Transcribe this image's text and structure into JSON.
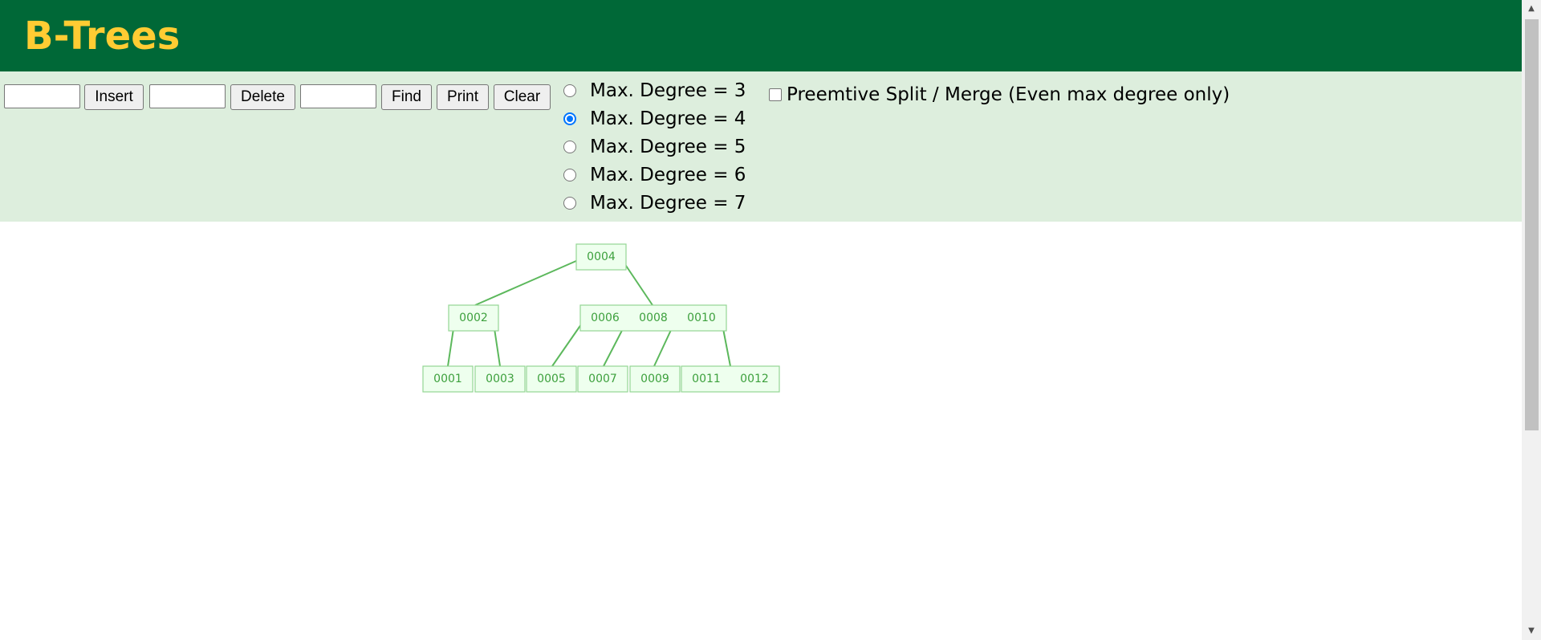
{
  "header": {
    "title": "B-Trees"
  },
  "toolbar": {
    "insert_value": "",
    "insert_label": "Insert",
    "delete_value": "",
    "delete_label": "Delete",
    "find_value": "",
    "find_label": "Find",
    "print_label": "Print",
    "clear_label": "Clear"
  },
  "degree_options": [
    {
      "label": "Max. Degree = 3",
      "checked": false
    },
    {
      "label": "Max. Degree = 4",
      "checked": true
    },
    {
      "label": "Max. Degree = 5",
      "checked": false
    },
    {
      "label": "Max. Degree = 6",
      "checked": false
    },
    {
      "label": "Max. Degree = 7",
      "checked": false
    }
  ],
  "preemptive": {
    "label": "Preemtive Split / Merge (Even max degree only)",
    "checked": false
  },
  "tree": {
    "root": {
      "keys": [
        "0004"
      ]
    },
    "internal": [
      {
        "keys": [
          "0002"
        ]
      },
      {
        "keys": [
          "0006",
          "0008",
          "0010"
        ]
      }
    ],
    "leaves": [
      {
        "keys": [
          "0001"
        ]
      },
      {
        "keys": [
          "0003"
        ]
      },
      {
        "keys": [
          "0005"
        ]
      },
      {
        "keys": [
          "0007"
        ]
      },
      {
        "keys": [
          "0009"
        ]
      },
      {
        "keys": [
          "0011",
          "0012"
        ]
      }
    ]
  },
  "colors": {
    "header_bg": "#006837",
    "title": "#ffcc33",
    "controls_bg": "#ddeedd",
    "node_fill": "#eeffee",
    "node_stroke": "#94d694",
    "node_text": "#3da03d",
    "edge": "#5cb85c",
    "radio_checked": "#0075ff"
  },
  "scrollbar": {
    "up_icon": "triangle-up-icon",
    "down_icon": "triangle-down-icon"
  }
}
